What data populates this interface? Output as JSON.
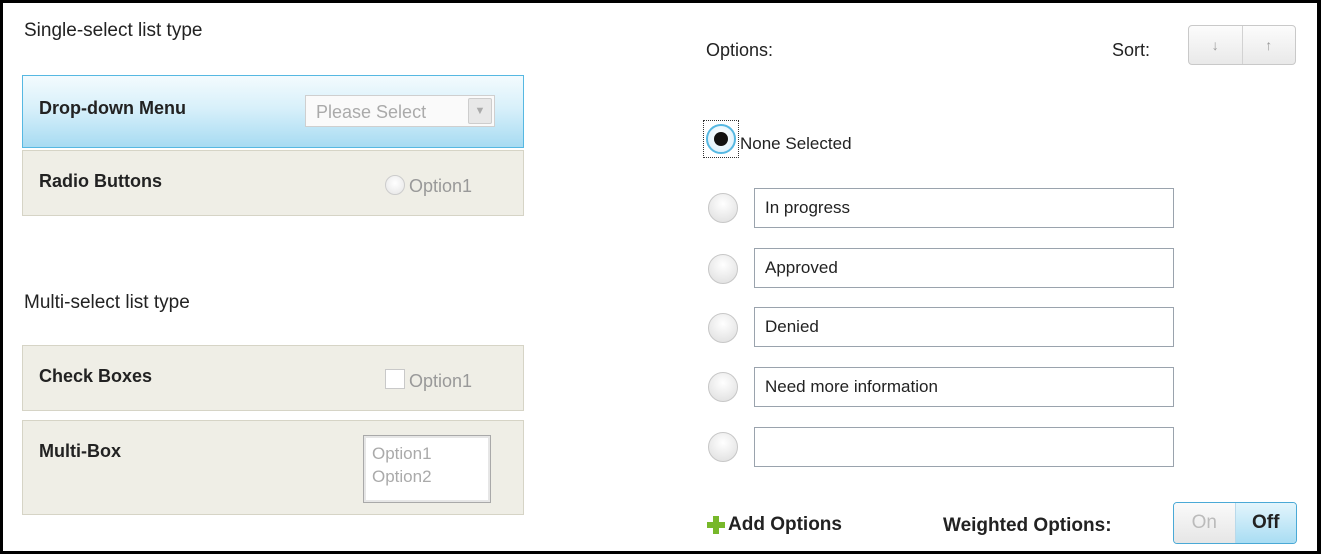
{
  "single_select": {
    "heading": "Single-select list type",
    "dropdown": {
      "label": "Drop-down Menu",
      "placeholder": "Please Select"
    },
    "radio": {
      "label": "Radio Buttons",
      "option": "Option1"
    }
  },
  "multi_select": {
    "heading": "Multi-select list type",
    "checkboxes": {
      "label": "Check Boxes",
      "option": "Option1"
    },
    "multibox": {
      "label": "Multi-Box",
      "options": [
        "Option1",
        "Option2"
      ]
    }
  },
  "options_panel": {
    "label": "Options:",
    "sort_label": "Sort:",
    "sort_down": "↓",
    "sort_up": "↑",
    "none_selected": "None Selected",
    "options": [
      "In progress",
      "Approved",
      "Denied",
      "Need more information",
      ""
    ],
    "add_options": "Add Options",
    "weighted_label": "Weighted Options:",
    "toggle_on": "On",
    "toggle_off": "Off"
  },
  "colors": {
    "accent": "#56b8e2",
    "card_bg": "#efeee6",
    "add_icon": "#77b82a"
  }
}
